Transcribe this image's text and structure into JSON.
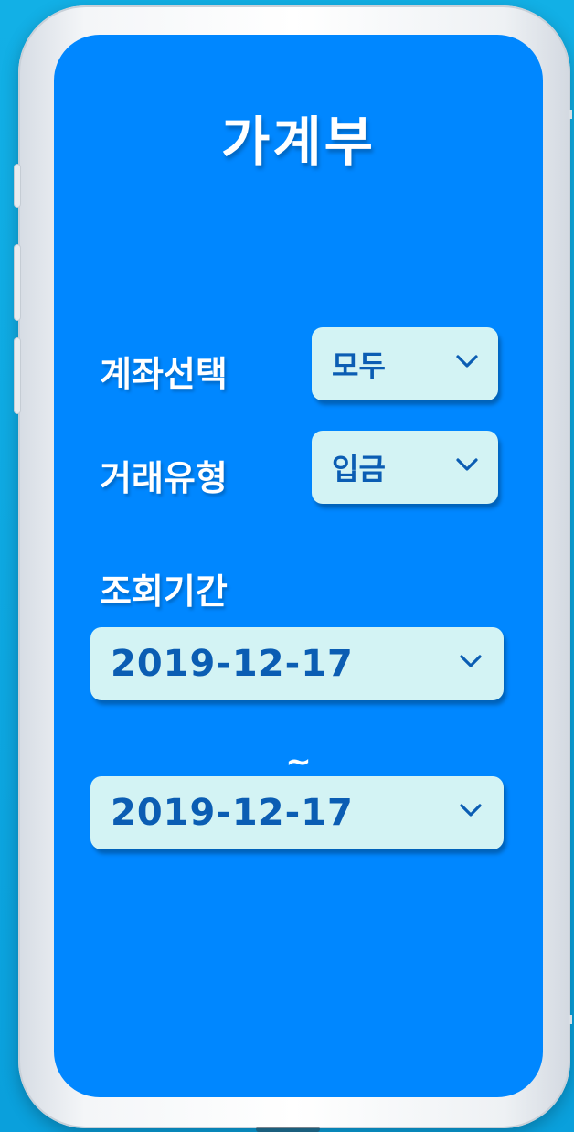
{
  "app": {
    "title": "가계부"
  },
  "filters": {
    "account": {
      "label": "계좌선택",
      "value": "모두"
    },
    "type": {
      "label": "거래유형",
      "value": "입금"
    },
    "period": {
      "label": "조회기간",
      "start": "2019-12-17",
      "separator": "~",
      "end": "2019-12-17"
    }
  },
  "icons": {
    "dropdown": "chevron-down-icon"
  },
  "colors": {
    "screen_background": "#0087ff",
    "select_background": "#d3f3f4",
    "select_text": "#0b5db3",
    "label_text": "#ffffff"
  }
}
